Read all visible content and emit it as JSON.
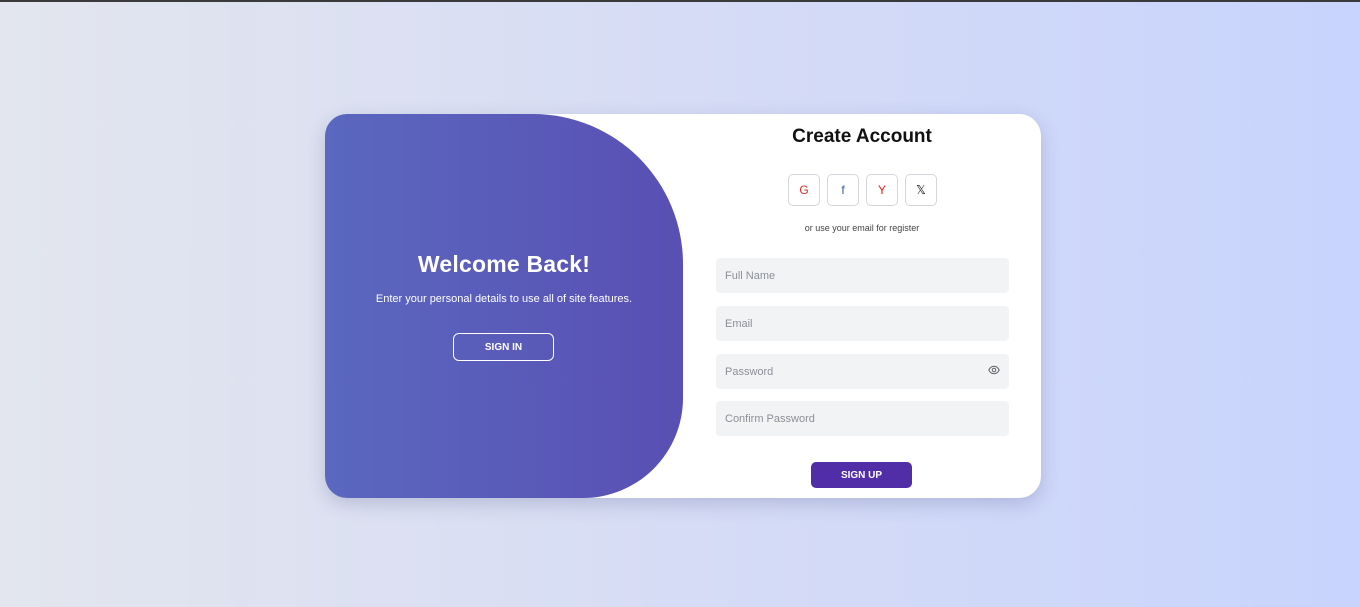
{
  "welcome": {
    "title": "Welcome Back!",
    "text": "Enter your personal details to use all of site features.",
    "signin_label": "SIGN IN"
  },
  "form": {
    "title": "Create Account",
    "social": [
      {
        "glyph": "G",
        "icon": "google-icon",
        "color": "#d93025"
      },
      {
        "glyph": "f",
        "icon": "facebook-icon",
        "color": "#3b5998"
      },
      {
        "glyph": "Y",
        "icon": "yahoo-icon",
        "color": "#e0201c"
      },
      {
        "glyph": "𝕏",
        "icon": "x-icon",
        "color": "#111111"
      }
    ],
    "alt_text": "or use your email for register",
    "fields": {
      "full_name": {
        "placeholder": "Full Name",
        "value": ""
      },
      "email": {
        "placeholder": "Email",
        "value": ""
      },
      "password": {
        "placeholder": "Password",
        "value": ""
      },
      "confirm_password": {
        "placeholder": "Confirm Password",
        "value": ""
      }
    },
    "signup_label": "SIGN UP"
  },
  "colors": {
    "panel_gradient_start": "#5a68bf",
    "panel_gradient_end": "#594fb4",
    "accent": "#512da8",
    "input_bg": "#f2f3f5"
  }
}
